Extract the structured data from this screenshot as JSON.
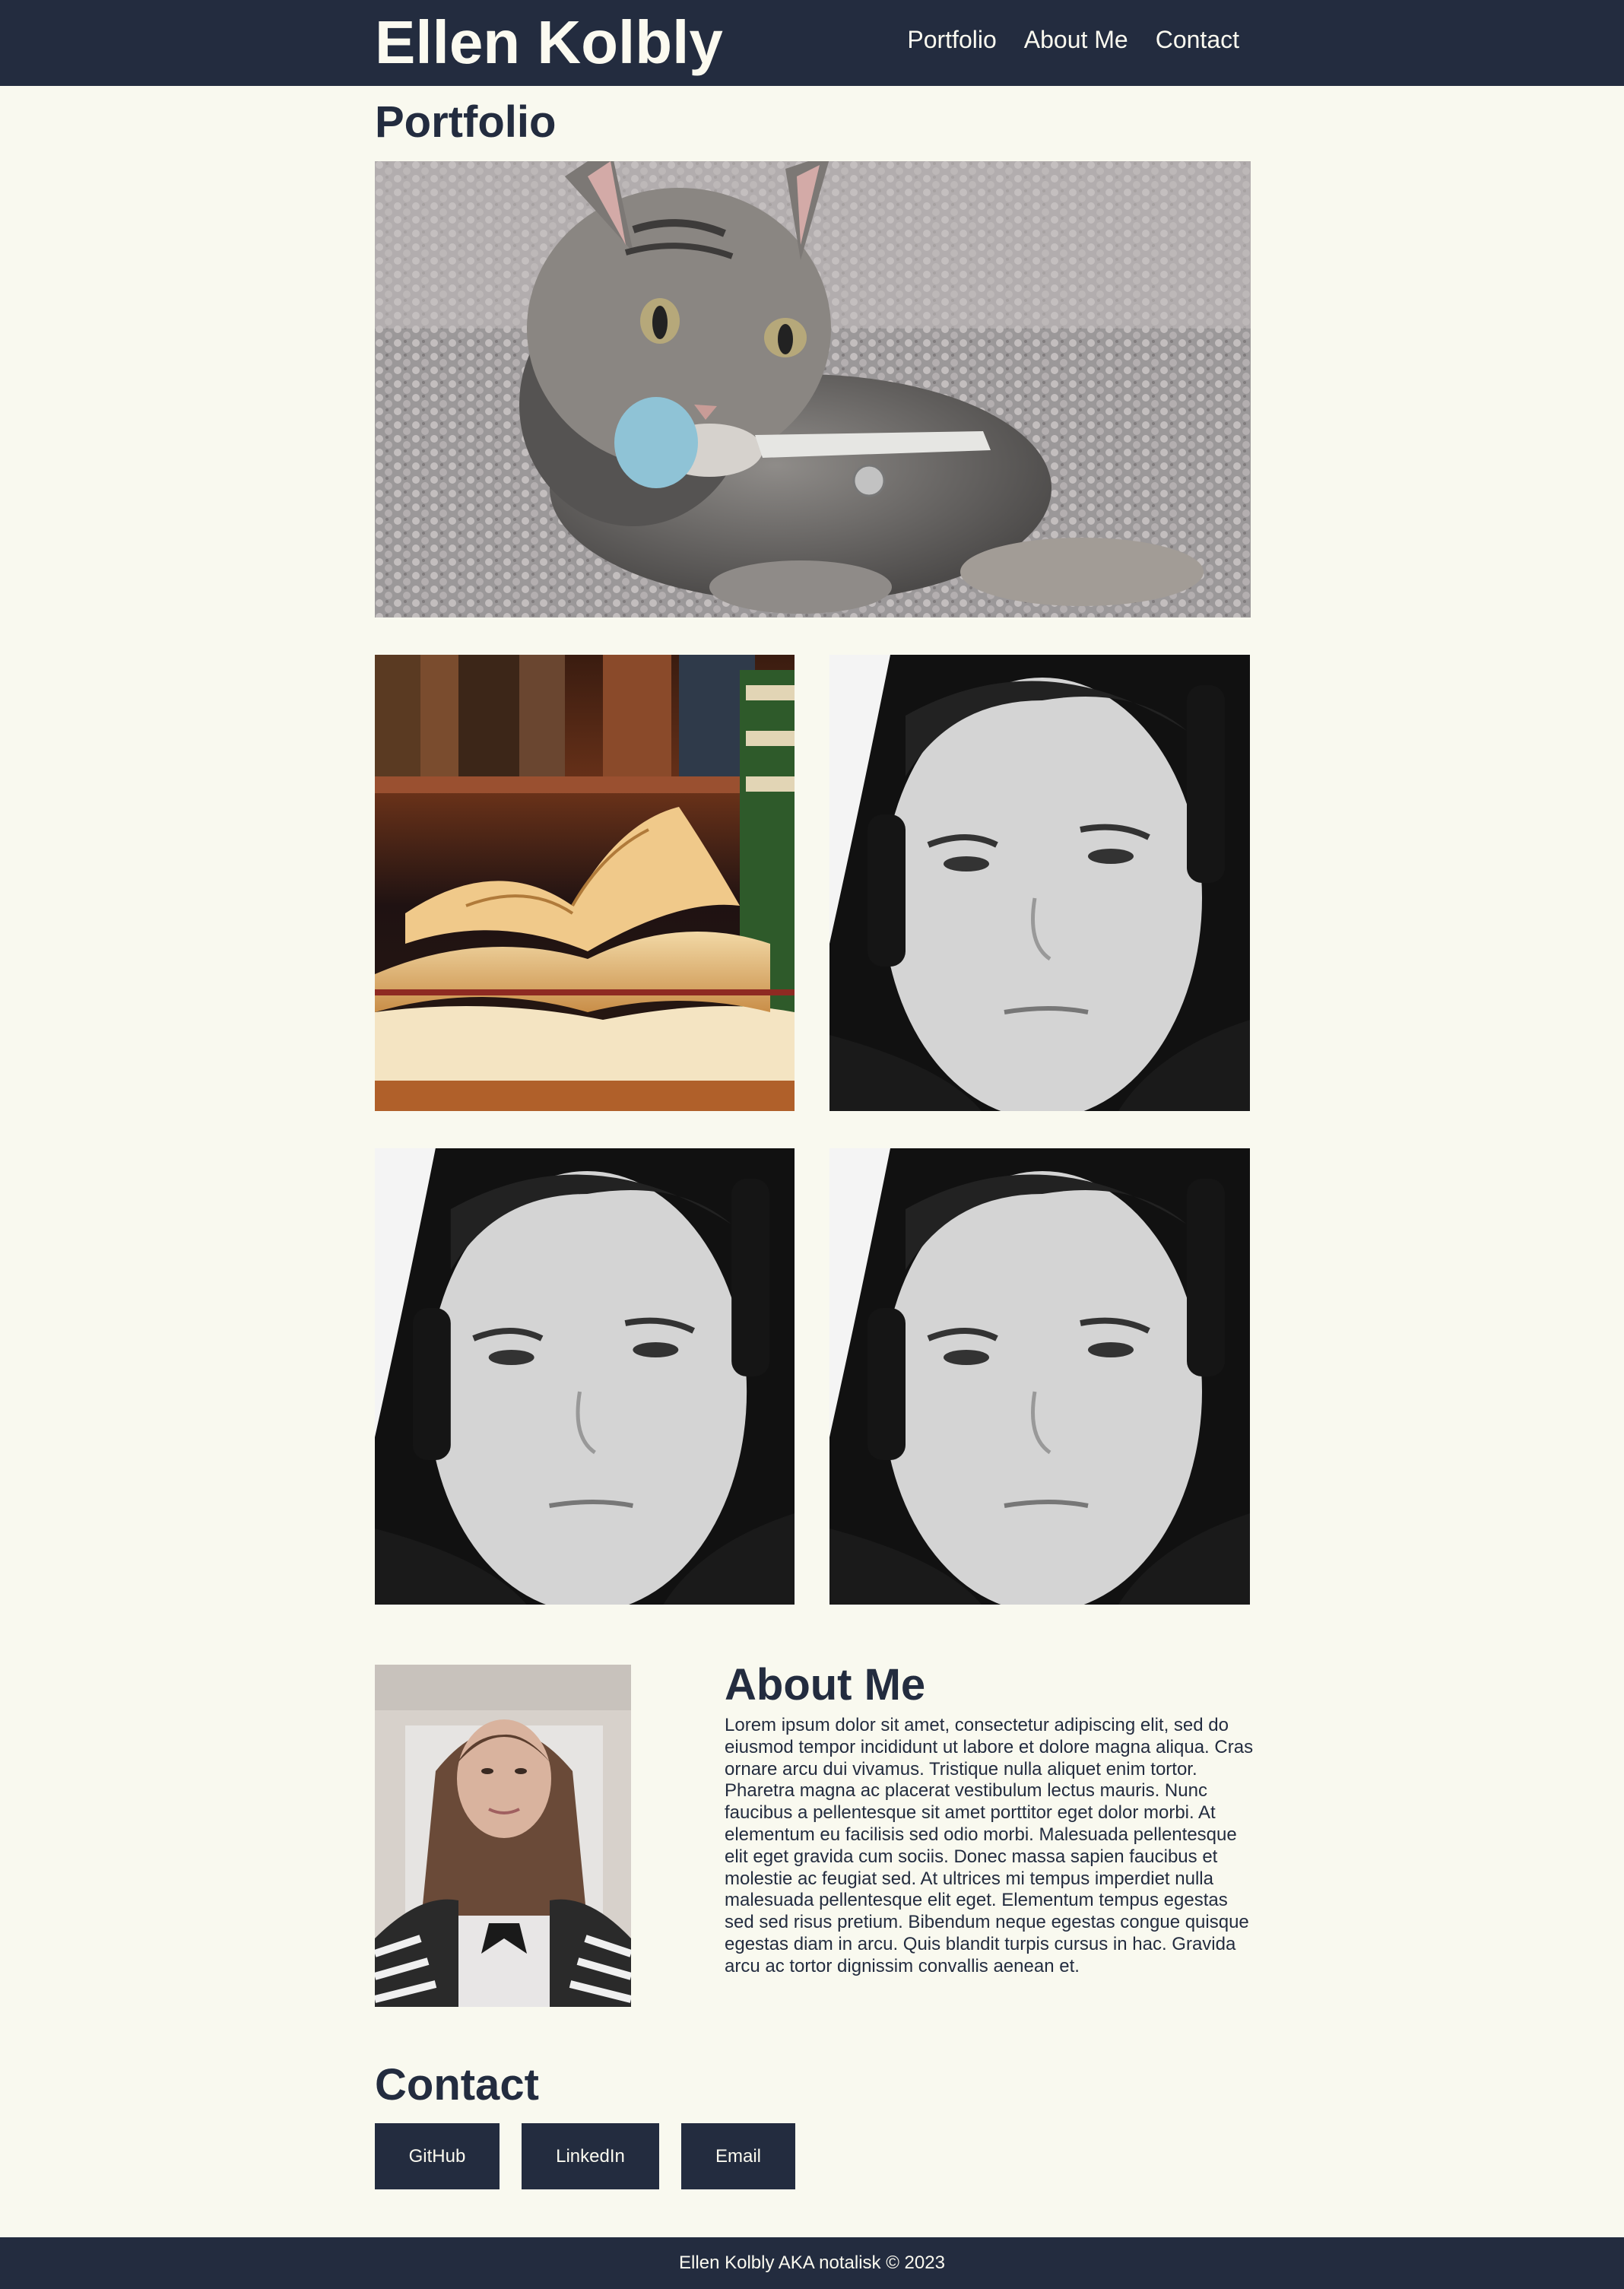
{
  "header": {
    "site_title": "Ellen Kolbly",
    "nav": [
      "Portfolio",
      "About Me",
      "Contact"
    ]
  },
  "portfolio": {
    "heading": "Portfolio",
    "images": [
      {
        "name": "cat-photo",
        "subject": "kitten on carpet"
      },
      {
        "name": "books-photo",
        "subject": "open books"
      },
      {
        "name": "portrait-photo-1",
        "subject": "portrait with headphones"
      },
      {
        "name": "portrait-photo-2",
        "subject": "portrait with headphones"
      },
      {
        "name": "portrait-photo-3",
        "subject": "portrait with headphones"
      }
    ]
  },
  "about": {
    "heading": "About Me",
    "text": "Lorem ipsum dolor sit amet, consectetur adipiscing elit, sed do eiusmod tempor incididunt ut labore et dolore magna aliqua. Cras ornare arcu dui vivamus. Tristique nulla aliquet enim tortor. Pharetra magna ac placerat vestibulum lectus mauris. Nunc faucibus a pellentesque sit amet porttitor eget dolor morbi. At elementum eu facilisis sed odio morbi. Malesuada pellentesque elit eget gravida cum sociis. Donec massa sapien faucibus et molestie ac feugiat sed. At ultrices mi tempus imperdiet nulla malesuada pellentesque elit eget. Elementum tempus egestas sed sed risus pretium. Bibendum neque egestas congue quisque egestas diam in arcu. Quis blandit turpis cursus in hac. Gravida arcu ac tortor dignissim convallis aenean et."
  },
  "contact": {
    "heading": "Contact",
    "buttons": [
      "GitHub",
      "LinkedIn",
      "Email"
    ]
  },
  "footer": {
    "text": "Ellen Kolbly AKA notalisk © 2023"
  },
  "colors": {
    "navy": "#232c3f",
    "cream": "#f9f9ef"
  }
}
